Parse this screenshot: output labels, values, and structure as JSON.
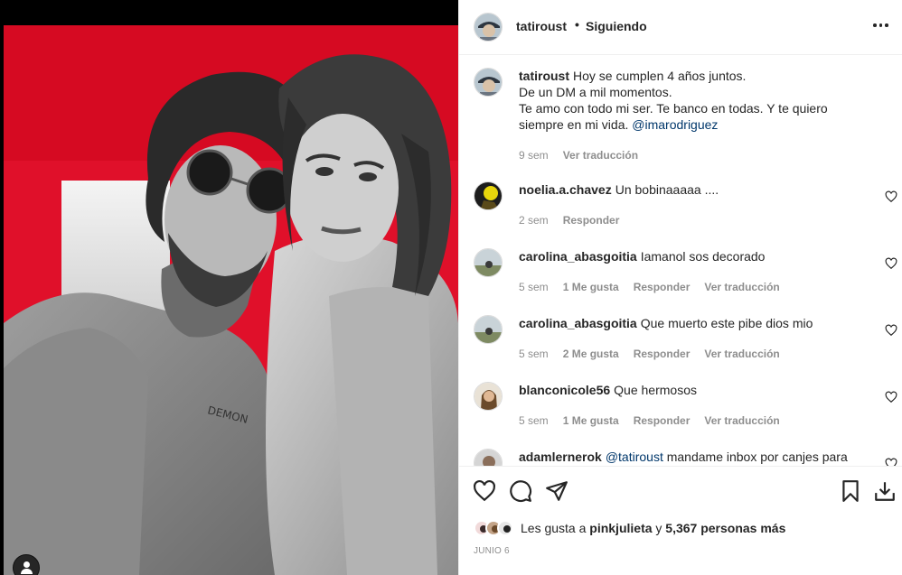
{
  "post": {
    "author": "tatiroust",
    "separator": "•",
    "follow_status": "Siguiendo",
    "caption_lines": [
      "Hoy se cumplen 4 años juntos.",
      "De un DM a mil momentos.",
      "Te amo con todo mi ser. Te banco en todas. Y te quiero siempre en mi vida."
    ],
    "caption_mention": "@imarodriguez",
    "caption_age": "9 sem",
    "caption_translate": "Ver traducción"
  },
  "comments": [
    {
      "user": "noelia.a.chavez",
      "text": "Un bobinaaaaa ....",
      "age": "2 sem",
      "reply": "Responder"
    },
    {
      "user": "carolina_abasgoitia",
      "text": "Iamanol sos decorado",
      "age": "5 sem",
      "likes": "1 Me gusta",
      "reply": "Responder",
      "translate": "Ver traducción"
    },
    {
      "user": "carolina_abasgoitia",
      "text": "Que muerto este pibe dios mio",
      "age": "5 sem",
      "likes": "2 Me gusta",
      "reply": "Responder",
      "translate": "Ver traducción"
    },
    {
      "user": "blanconicole56",
      "text": "Que hermosos",
      "age": "5 sem",
      "likes": "1 Me gusta",
      "reply": "Responder",
      "translate": "Ver traducción"
    },
    {
      "user": "adamlernerok",
      "mention": "@tatiroust",
      "text": "mandame inbox por canjes para"
    }
  ],
  "likes": {
    "prefix": "Les gusta a",
    "first_user": "pinkjulieta",
    "joiner": "y",
    "others": "5,367 personas más"
  },
  "date": "JUNIO 6",
  "icons": {
    "like": "heart-icon",
    "comment": "comment-icon",
    "share": "share-icon",
    "save": "bookmark-icon",
    "download": "download-icon",
    "more": "more-options-icon",
    "user_tag": "user-tag-icon"
  },
  "colors": {
    "photo_background": "#e0102a",
    "text": "#262626",
    "secondary_text": "#8e8e8e",
    "mention": "#00376b"
  }
}
